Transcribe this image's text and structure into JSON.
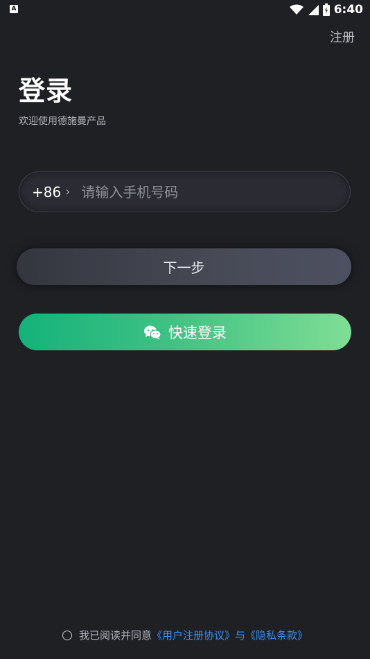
{
  "status_bar": {
    "left_icon": "A",
    "time": "6:40",
    "icons": [
      "wifi-icon",
      "signal-icon",
      "battery-icon"
    ]
  },
  "header": {
    "register_label": "注册"
  },
  "main": {
    "title": "登录",
    "subtitle": "欢迎使用德施曼产品",
    "country_code": "+86",
    "country_code_arrow": "›",
    "phone_placeholder": "请输入手机号码",
    "phone_value": "",
    "next_button": "下一步",
    "quick_login_button": "快速登录"
  },
  "footer": {
    "agree_text": "我已阅读并同意",
    "user_agreement_link": "《用户注册协议》",
    "and_text": "与",
    "privacy_link": "《隐私条款》"
  },
  "colors": {
    "background": "#1f2024",
    "link": "#3a8ef6",
    "wechat_gradient_start": "#14b27a",
    "wechat_gradient_end": "#7fde94"
  }
}
